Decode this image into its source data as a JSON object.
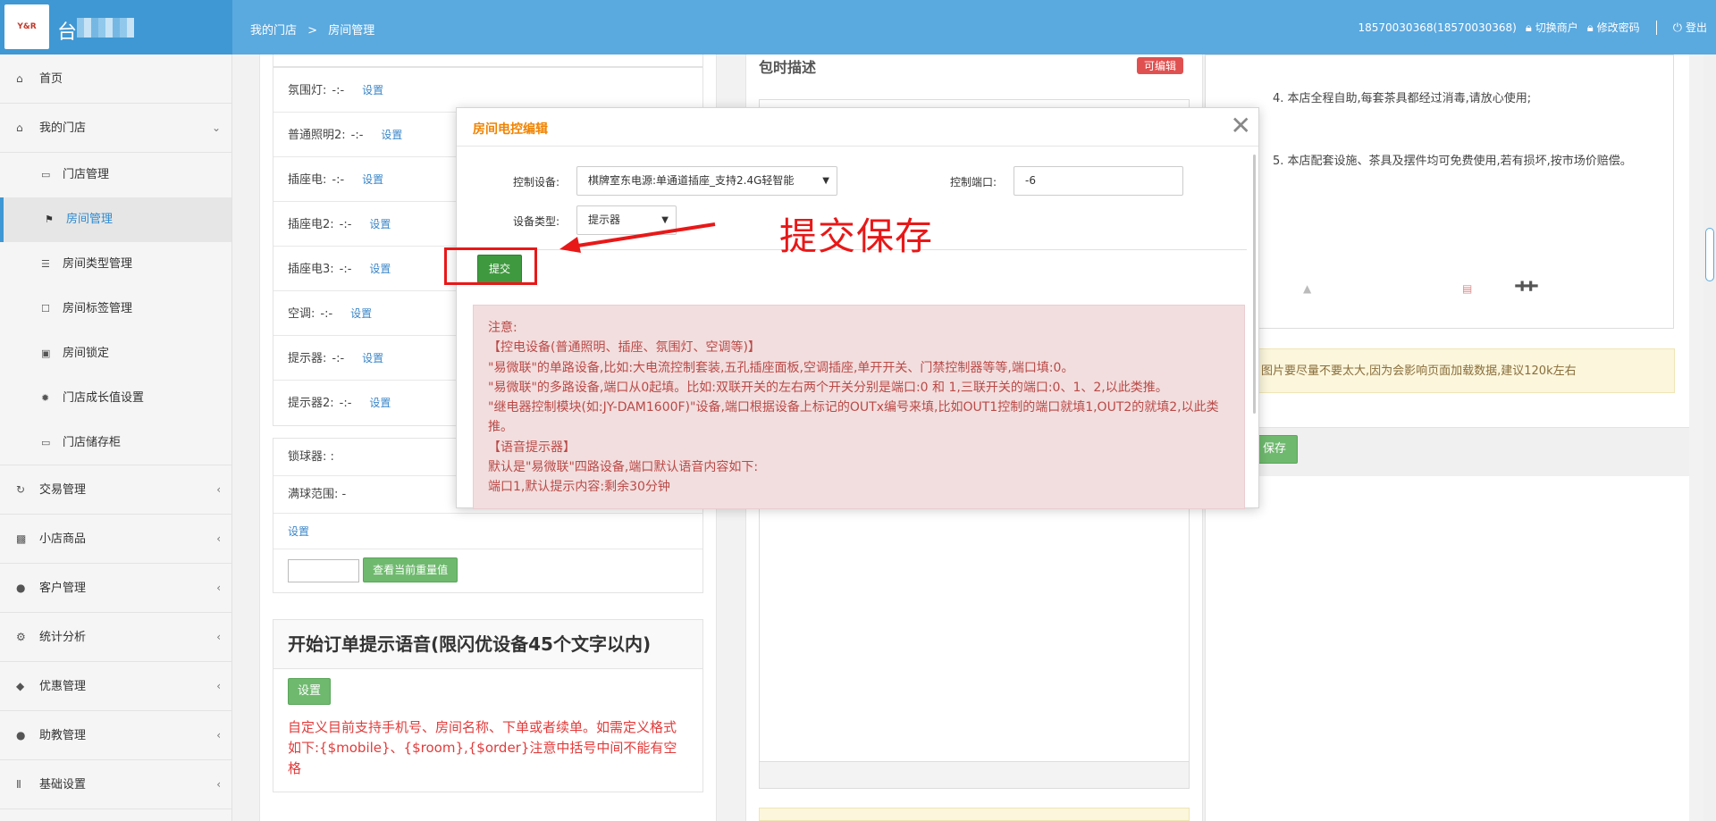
{
  "header": {
    "logo_text": "Y&R",
    "brand_name": "台",
    "breadcrumb": [
      "我的门店",
      ">",
      "房间管理"
    ],
    "account": "18570030368(18570030368)",
    "switch_merchant": "切换商户",
    "change_password": "修改密码",
    "logout": "登出"
  },
  "sidebar": {
    "items": [
      {
        "label": "首页",
        "icon": "home-icon"
      },
      {
        "label": "我的门店",
        "icon": "home-icon"
      },
      {
        "label": "门店管理",
        "icon": "inbox-icon"
      },
      {
        "label": "房间管理",
        "icon": "flag-icon"
      },
      {
        "label": "房间类型管理",
        "icon": "list-icon"
      },
      {
        "label": "房间标签管理",
        "icon": "bookmark-icon"
      },
      {
        "label": "房间锁定",
        "icon": "lock-icon"
      },
      {
        "label": "门店成长值设置",
        "icon": "cog-icon"
      },
      {
        "label": "门店储存柜",
        "icon": "inbox-icon"
      },
      {
        "label": "交易管理",
        "icon": "refresh-icon"
      },
      {
        "label": "小店商品",
        "icon": "gift-icon"
      },
      {
        "label": "客户管理",
        "icon": "user-icon"
      },
      {
        "label": "统计分析",
        "icon": "cog-icon"
      },
      {
        "label": "优惠管理",
        "icon": "tags-icon"
      },
      {
        "label": "助教管理",
        "icon": "user-icon"
      },
      {
        "label": "基础设置",
        "icon": "barcode-icon"
      }
    ]
  },
  "devices": {
    "rows": [
      {
        "label": "氛围灯:",
        "value": "-:-",
        "action": "设置"
      },
      {
        "label": "普通照明2:",
        "value": "-:-",
        "action": "设置"
      },
      {
        "label": "插座电:",
        "value": "-:-",
        "action": "设置"
      },
      {
        "label": "插座电2:",
        "value": "-:-",
        "action": "设置"
      },
      {
        "label": "插座电3:",
        "value": "-:-",
        "action": "设置"
      },
      {
        "label": "空调:",
        "value": "-:-",
        "action": "设置"
      },
      {
        "label": "提示器:",
        "value": "-:-",
        "action": "设置"
      },
      {
        "label": "提示器2:",
        "value": "-:-",
        "action": "设置"
      }
    ]
  },
  "ball_lock": {
    "lock_label": "锁球器: :",
    "range_label": "满球范围: -",
    "set_link": "设置",
    "check_button": "查看当前重量值"
  },
  "voice": {
    "title": "开始订单提示语音(限闪优设备45个文字以内)",
    "set_button": "设置",
    "note": "自定义目前支持手机号、房间名称、下单或者续单。如需定义格式如下:{$mobile}、{$room},{$order}注意中括号中间不能有空格"
  },
  "middle": {
    "title": "包时描述",
    "badge": "可编辑"
  },
  "right": {
    "text1": "4. 本店全程自助,每套茶具都经过消毒,请放心使用;",
    "text2": "5. 本店配套设施、茶具及摆件均可免费使用,若有损坏,按市场价赔偿。",
    "image_text": "艹",
    "tip": "图片要尽量不要太大,因为会影响页面加载数据,建议120k左右",
    "save": "保存"
  },
  "modal": {
    "title": "房间电控编辑",
    "device_label": "控制设备:",
    "device_value": "棋牌室东电源:单通道插座_支持2.4G轻智能",
    "port_label": "控制端口:",
    "port_value": "-6",
    "type_label": "设备类型:",
    "type_value": "提示器",
    "submit": "提交",
    "notice": [
      "注意:",
      "【控电设备(普通照明、插座、氛围灯、空调等)】",
      "\"易微联\"的单路设备,比如:大电流控制套装,五孔插座面板,空调插座,单开开关、门禁控制器等等,端口填:0。",
      "\"易微联\"的多路设备,端口从0起填。比如:双联开关的左右两个开关分别是端口:0 和 1,三联开关的端口:0、1、2,以此类推。",
      "\"继电器控制模块(如:JY-DAM1600F)\"设备,端口根据设备上标记的OUTx编号来填,比如OUT1控制的端口就填1,OUT2的就填2,以此类推。",
      "【语音提示器】",
      "默认是\"易微联\"四路设备,端口默认语音内容如下:",
      "端口1,默认提示内容:剩余30分钟"
    ]
  },
  "annotation": {
    "text": "提交保存",
    "color": "#e81818"
  }
}
